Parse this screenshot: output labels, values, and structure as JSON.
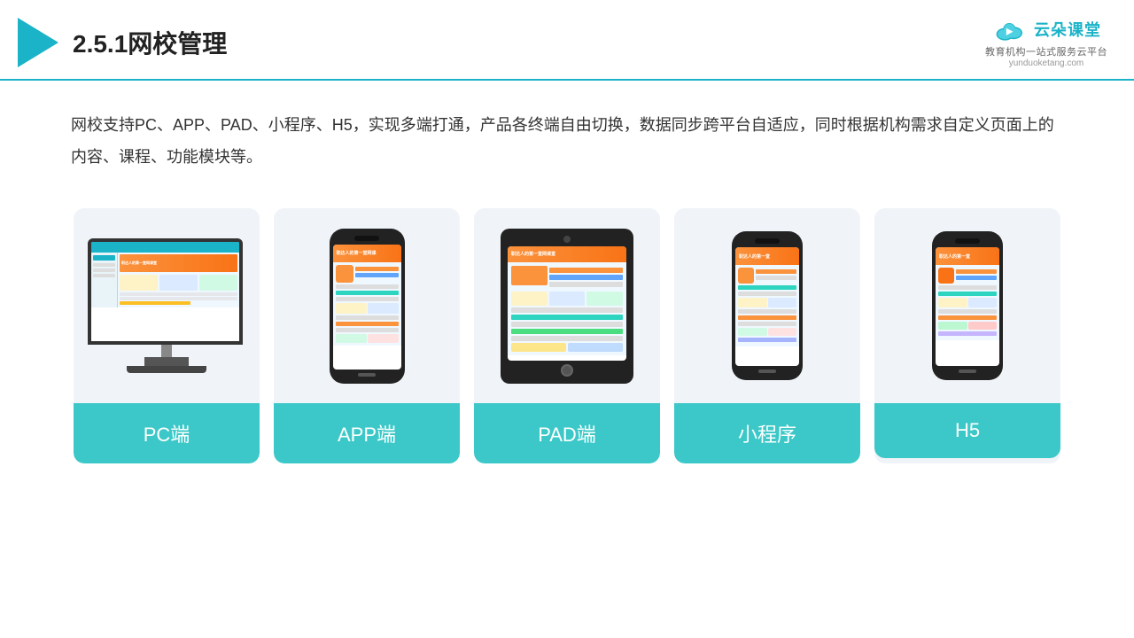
{
  "header": {
    "title": "2.5.1网校管理",
    "brand": {
      "name": "云朵课堂",
      "url": "yunduoketang.com",
      "slogan": "教育机构一站式服务云平台"
    }
  },
  "description": "网校支持PC、APP、PAD、小程序、H5，实现多端打通，产品各终端自由切换，数据同步跨平台自适应，同时根据机构需求自定义页面上的内容、课程、功能模块等。",
  "cards": [
    {
      "id": "pc",
      "label": "PC端",
      "type": "pc"
    },
    {
      "id": "app",
      "label": "APP端",
      "type": "phone"
    },
    {
      "id": "pad",
      "label": "PAD端",
      "type": "tablet"
    },
    {
      "id": "miniprogram",
      "label": "小程序",
      "type": "phone"
    },
    {
      "id": "h5",
      "label": "H5",
      "type": "phone"
    }
  ]
}
